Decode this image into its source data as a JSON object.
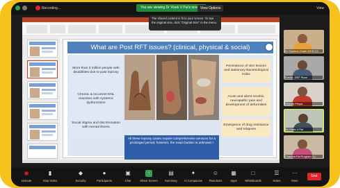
{
  "topbar": {
    "recording_label": "Recording...",
    "viewing_banner": "You are viewing Dr Vivek V Pai's screen",
    "view_options": "View Options",
    "view_right": "View"
  },
  "tooltip": {
    "text": "The shared content is fit to your screen. To see the original size, click \"Original Size\" in the menu."
  },
  "slide": {
    "title": "What are Post RFT issues? (clinical, physical & social)",
    "left_boxes": [
      "More than 3 million people with disabilities due to past leprosy",
      "Chronic & recurrent ENL reactions with systemic dysfunctions",
      "Social stigma and discrimination with mental illness"
    ],
    "right_boxes": [
      "Persistence of skin lesions and stationary Bacteriological index",
      "Acute and silent neuritis, neuropathic pain and development of deformities",
      "Emergence of drug resistance and relapses"
    ],
    "caption": "All these leprosy cases require comprehensive services for a prolonged period; however, the exact burden is unknown !"
  },
  "participants": [
    {
      "name": "Dr Sushma Ghate WHO CC",
      "icon": "participant-video"
    },
    {
      "name": "Sushil...DEF Pune",
      "icon": "participant-video"
    },
    {
      "name": "Vineeta Pimpa",
      "icon": "participant-video"
    },
    {
      "name": "Dr Vivek V Pai",
      "icon": "participant-video"
    },
    {
      "name": "Chandra Pai Program Co...",
      "icon": "participant-video"
    }
  ],
  "toolbar": {
    "items": [
      {
        "label": "Unmute",
        "icon": "mic-muted-icon"
      },
      {
        "label": "Stop Video",
        "icon": "video-icon"
      },
      {
        "label": "Security",
        "icon": "shield-icon"
      },
      {
        "label": "Participants",
        "icon": "participants-icon"
      },
      {
        "label": "Chat",
        "icon": "chat-icon"
      },
      {
        "label": "Share Screen",
        "icon": "share-screen-icon"
      },
      {
        "label": "Summary",
        "icon": "summary-icon"
      },
      {
        "label": "AI Companion",
        "icon": "ai-companion-icon"
      },
      {
        "label": "Reactions",
        "icon": "reactions-icon"
      },
      {
        "label": "Apps",
        "icon": "apps-icon"
      },
      {
        "label": "Whiteboards",
        "icon": "whiteboard-icon"
      },
      {
        "label": "Notes",
        "icon": "notes-icon"
      },
      {
        "label": "More",
        "icon": "more-icon"
      }
    ],
    "end_label": "End"
  },
  "colors": {
    "frame": "#f6c21c",
    "title_bar": "#4f81bd",
    "banner": "#1f8b3a",
    "end": "#e0262b"
  }
}
